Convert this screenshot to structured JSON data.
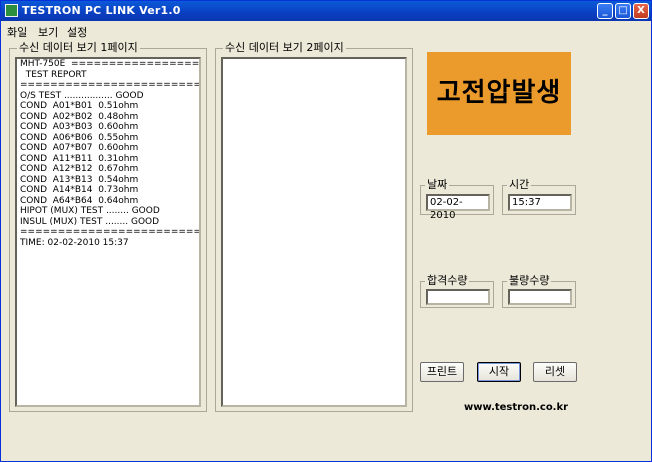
{
  "window": {
    "title": "TESTRON PC LINK Ver1.0",
    "minimize": "_",
    "maximize": "□",
    "close": "X"
  },
  "menu": [
    "화일",
    "보기",
    "설정"
  ],
  "page1": {
    "label": "수신 데이터 보기 1페이지",
    "lines": [
      "MHT-750E  ==============================",
      "  TEST REPORT",
      "=================================",
      "O/S TEST ................. GOOD",
      "COND  A01*B01  0.51ohm",
      "COND  A02*B02  0.48ohm",
      "COND  A03*B03  0.60ohm",
      "COND  A06*B06  0.55ohm",
      "COND  A07*B07  0.60ohm",
      "COND  A11*B11  0.31ohm",
      "COND  A12*B12  0.67ohm",
      "COND  A13*B13  0.54ohm",
      "COND  A14*B14  0.73ohm",
      "COND  A64*B64  0.64ohm",
      "HIPOT (MUX) TEST ........ GOOD",
      "INSUL (MUX) TEST ........ GOOD",
      "=================================",
      "TIME: 02-02-2010 15:37"
    ]
  },
  "page2": {
    "label": "수신 데이터 보기 2페이지"
  },
  "logo": {
    "text": "고전압발생",
    "color": "#eb9b2c"
  },
  "date": {
    "label": "날짜",
    "value": "02-02-2010"
  },
  "time": {
    "label": "시간",
    "value": "15:37"
  },
  "pass_count": {
    "label": "합격수량",
    "value": ""
  },
  "fail_count": {
    "label": "불량수량",
    "value": ""
  },
  "buttons": {
    "print": "프린트",
    "start": "시작",
    "reset": "리셋"
  },
  "url": "www.testron.co.kr"
}
